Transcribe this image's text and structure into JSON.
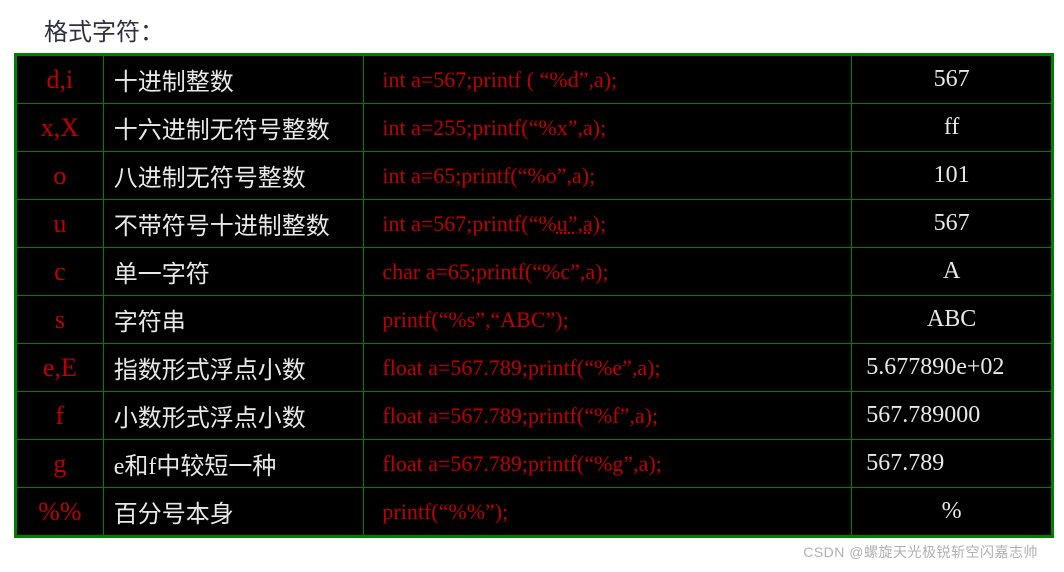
{
  "title": "格式字符：",
  "rows": [
    {
      "spec": "d,i",
      "desc": "十进制整数",
      "code": "int a=567;printf ( “%d”,a);",
      "out": "567",
      "out_align": "center"
    },
    {
      "spec": "x,X",
      "desc": "十六进制无符号整数",
      "code": "int a=255;printf(“%x”,a);",
      "out": "ff",
      "out_align": "center"
    },
    {
      "spec": "o",
      "desc": "八进制无符号整数",
      "code": "int a=65;printf(“%o”,a);",
      "out": "101",
      "out_align": "center"
    },
    {
      "spec": "u",
      "desc": "不带符号十进制整数",
      "code_html": "int a=567;printf(“%<span class=\"u-under\">u”,a</span>);",
      "out": "567",
      "out_align": "center"
    },
    {
      "spec": "c",
      "desc": "单一字符",
      "code": "char a=65;printf(“%c”,a);",
      "out": "A",
      "out_align": "center"
    },
    {
      "spec": "s",
      "desc": "字符串",
      "code": "printf(“%s”,“ABC”);",
      "out": "ABC",
      "out_align": "center"
    },
    {
      "spec": "e,E",
      "desc": "指数形式浮点小数",
      "code": "float a=567.789;printf(“%e”,a);",
      "out": "5.677890e+02",
      "out_align": "left"
    },
    {
      "spec": "f",
      "desc": "小数形式浮点小数",
      "code": "float a=567.789;printf(“%f”,a);",
      "out": "567.789000",
      "out_align": "left"
    },
    {
      "spec": "g",
      "desc": "e和f中较短一种",
      "code": "float a=567.789;printf(“%g”,a);",
      "out": "567.789",
      "out_align": "left"
    },
    {
      "spec": "%%",
      "desc": "百分号本身",
      "code": "printf(“%%”);",
      "out": "%",
      "out_align": "center"
    }
  ],
  "watermark": "CSDN @螺旋天光极锐斩空闪嘉志帅"
}
